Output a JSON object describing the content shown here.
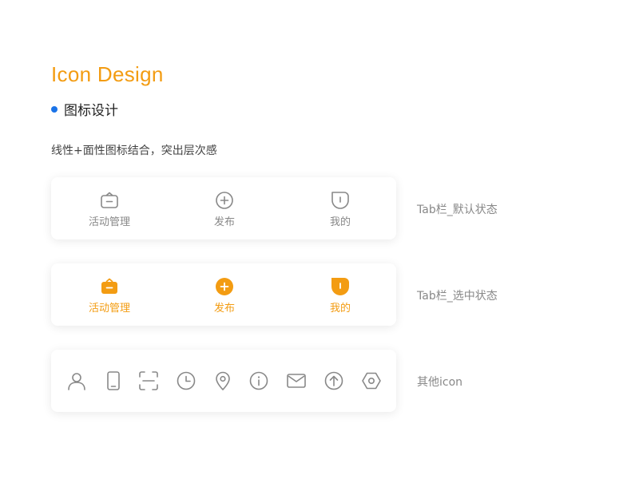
{
  "header": {
    "title": "Icon Design",
    "subtitle": "图标设计",
    "description": "线性+面性图标结合，突出层次感"
  },
  "colors": {
    "accent": "#f39c12",
    "bullet": "#1a73e8",
    "icon_line": "#888888"
  },
  "tab_default": {
    "note": "Tab栏_默认状态",
    "items": [
      {
        "label": "活动管理",
        "icon": "bag-icon"
      },
      {
        "label": "发布",
        "icon": "plus-circle-icon"
      },
      {
        "label": "我的",
        "icon": "profile-icon"
      }
    ]
  },
  "tab_selected": {
    "note": "Tab栏_选中状态",
    "items": [
      {
        "label": "活动管理",
        "icon": "bag-icon-filled"
      },
      {
        "label": "发布",
        "icon": "plus-circle-icon-filled"
      },
      {
        "label": "我的",
        "icon": "profile-icon-filled"
      }
    ]
  },
  "other_icons": {
    "note": "其他icon",
    "items": [
      "user-icon",
      "phone-icon",
      "scan-icon",
      "clock-icon",
      "location-pin-icon",
      "info-icon",
      "mail-icon",
      "upload-icon",
      "settings-icon"
    ]
  }
}
